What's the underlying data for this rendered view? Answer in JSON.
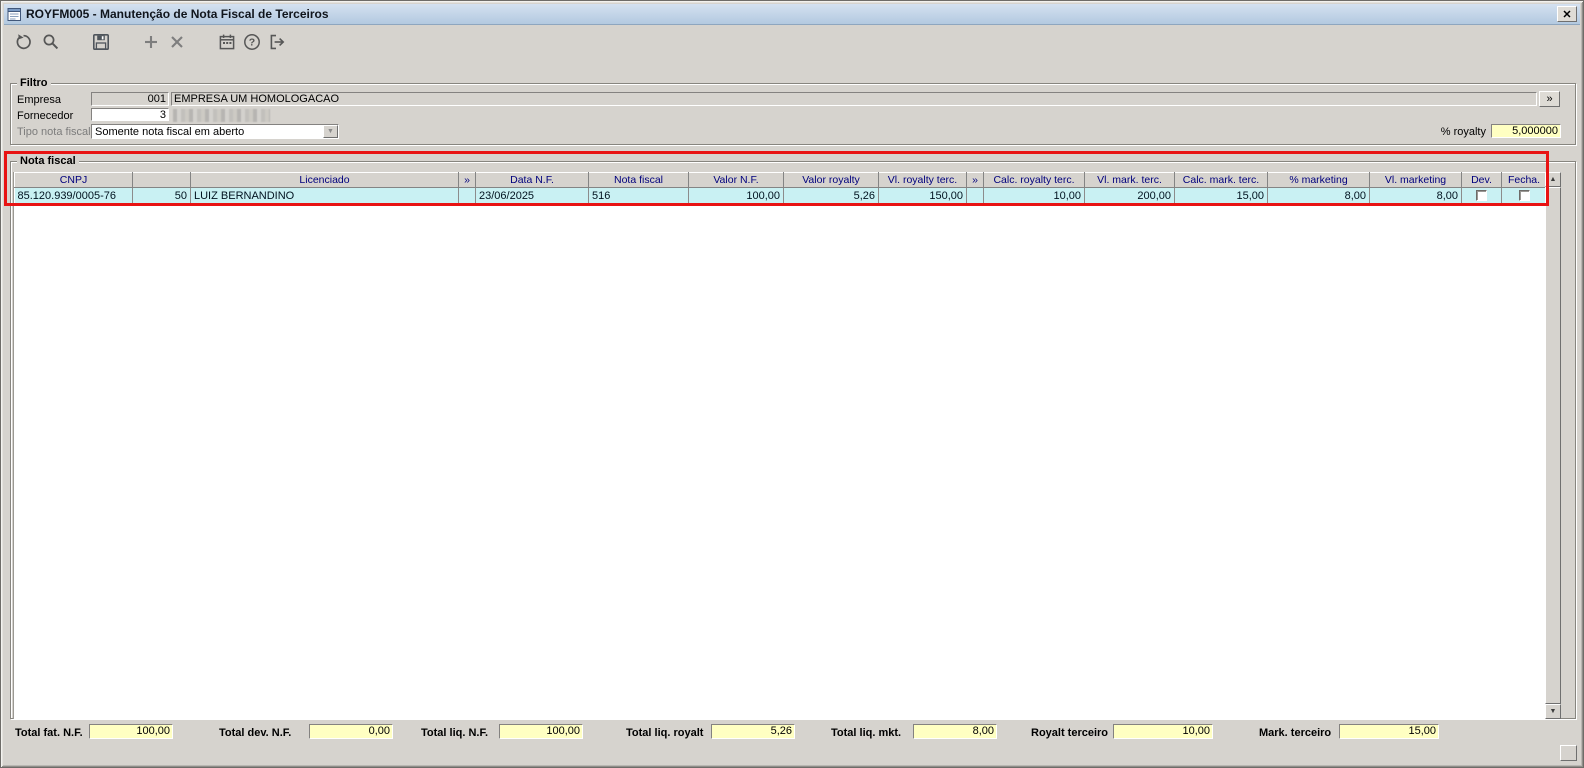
{
  "window": {
    "title": "ROYFM005 - Manutenção de Nota Fiscal de Terceiros"
  },
  "icons": {
    "close": "✕",
    "combo_arrow": "▼",
    "scroll_up": "▲",
    "scroll_down": "▼"
  },
  "toolbar": {
    "buttons": [
      "undo",
      "search",
      "save",
      "add",
      "delete",
      "calendar",
      "help",
      "exit"
    ]
  },
  "filtro": {
    "legend": "Filtro",
    "empresa": {
      "label": "Empresa",
      "code": "001",
      "name": "EMPRESA UM HOMOLOGACAO",
      "lookup_label": "»"
    },
    "fornecedor": {
      "label": "Fornecedor",
      "code": "3",
      "name_redacted": true
    },
    "tipo_nota_fiscal": {
      "label": "Tipo nota fiscal",
      "value": "Somente nota fiscal em aberto"
    },
    "royalty": {
      "label": "% royalty",
      "value": "5,000000"
    }
  },
  "nota_fiscal": {
    "legend": "Nota fiscal",
    "columns": [
      "CNPJ",
      "",
      "Licenciado",
      "»",
      "Data N.F.",
      "Nota fiscal",
      "Valor N.F.",
      "Valor royalty",
      "Vl. royalty terc.",
      "»",
      "Calc. royalty terc.",
      "Vl. mark. terc.",
      "Calc. mark. terc.",
      "% marketing",
      "Vl. marketing",
      "Dev.",
      "Fecha."
    ],
    "rows": [
      {
        "cells": [
          "85.120.939/0005-76",
          "50",
          "LUIZ BERNANDINO",
          "",
          "23/06/2025",
          "516",
          "100,00",
          "5,26",
          "150,00",
          "",
          "10,00",
          "200,00",
          "15,00",
          "8,00",
          "8,00"
        ],
        "dev_checked": false,
        "fecha_checked": false
      }
    ]
  },
  "totals": [
    {
      "label": "Total fat. N.F.",
      "value": "100,00"
    },
    {
      "label": "Total dev. N.F.",
      "value": "0,00"
    },
    {
      "label": "Total liq. N.F.",
      "value": "100,00"
    },
    {
      "label": "Total liq. royalt",
      "value": "5,26"
    },
    {
      "label": "Total liq. mkt.",
      "value": "8,00"
    },
    {
      "label": "Royalt terceiro",
      "value": "10,00"
    },
    {
      "label": "Mark. terceiro",
      "value": "15,00"
    }
  ]
}
